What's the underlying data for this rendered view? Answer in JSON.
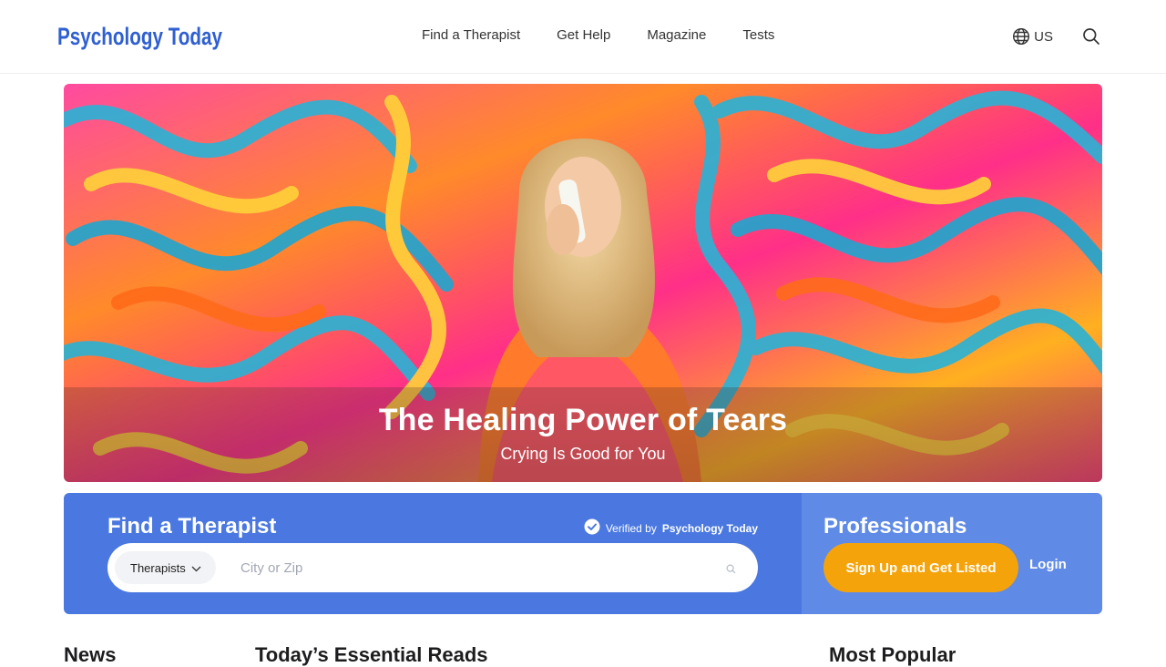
{
  "header": {
    "logo_text": "Psychology Today",
    "nav": [
      "Find a Therapist",
      "Get Help",
      "Magazine",
      "Tests"
    ],
    "locale": "US",
    "icons": {
      "globe": "globe-icon",
      "search": "search-icon"
    }
  },
  "hero": {
    "title": "The Healing Power of Tears",
    "subtitle": "Crying Is Good for You"
  },
  "finder": {
    "title": "Find a Therapist",
    "verified_prefix": "Verified by",
    "verified_brand": "Psychology Today",
    "select_value": "Therapists",
    "input_placeholder": "City or Zip",
    "input_value": ""
  },
  "professionals": {
    "title": "Professionals",
    "signup_label": "Sign Up and Get Listed",
    "login_label": "Login"
  },
  "sections": {
    "news": "News",
    "essential": "Today’s Essential Reads",
    "popular": "Most Popular"
  },
  "colors": {
    "brand_blue": "#2f5fd0",
    "finder_bg": "#4a78e0",
    "pro_bg": "#5f8ae6",
    "cta_orange": "#f5a30a"
  }
}
